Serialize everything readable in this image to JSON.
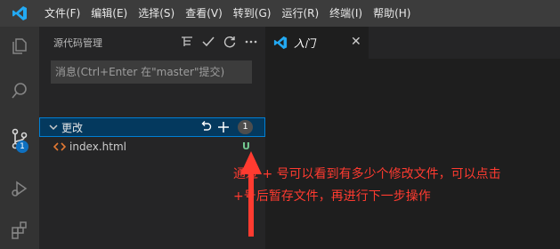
{
  "menubar": {
    "items": [
      "文件(F)",
      "编辑(E)",
      "选择(S)",
      "查看(V)",
      "转到(G)",
      "运行(R)",
      "终端(I)",
      "帮助(H)"
    ]
  },
  "activity_bar": {
    "icons": [
      "explorer-icon",
      "search-icon",
      "source-control-icon",
      "run-debug-icon",
      "extensions-icon"
    ],
    "source_control_badge": "1"
  },
  "sidebar": {
    "title": "源代码管理",
    "commit_placeholder": "消息(Ctrl+Enter 在\"master\"提交)",
    "changes_label": "更改",
    "changes_count": "1",
    "files": [
      {
        "name": "index.html",
        "status": "U"
      }
    ]
  },
  "editor": {
    "tab_label": "入门"
  },
  "annotation": {
    "line1": "通过 + 号可以看到有多少个修改文件，可以点击",
    "line2": "+号后暂存文件，再进行下一步操作"
  },
  "colors": {
    "accent": "#0e70c0",
    "annotation": "#ff3b30",
    "untracked": "#73c991"
  }
}
